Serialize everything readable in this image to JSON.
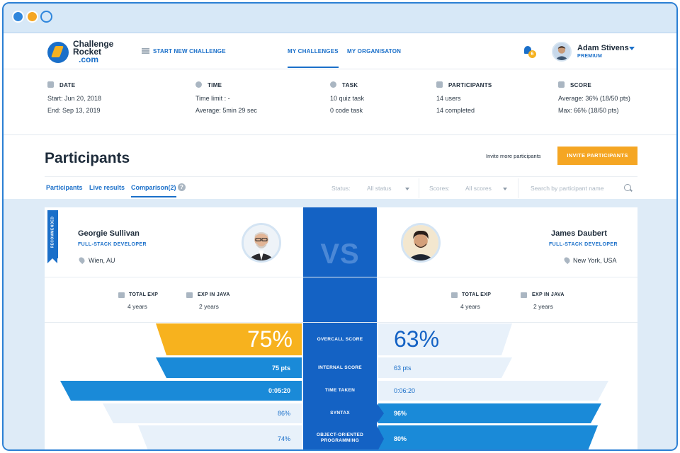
{
  "app": {
    "logo": {
      "line1": "Challenge",
      "line2": "Rocket",
      "line3": ".com"
    },
    "nav": {
      "new_challenge": "START NEW CHALLENGE",
      "my_challenges": "MY CHALLENGES",
      "my_organisation": "MY ORGANISATON"
    },
    "notifications": {
      "count": "6"
    },
    "user": {
      "name": "Adam Stivens",
      "plan": "PREMIUM"
    }
  },
  "stats": {
    "date": {
      "label": "DATE",
      "start": "Start: Jun 20, 2018",
      "end": "End: Sep 13, 2019"
    },
    "time": {
      "label": "TIME",
      "limit": "Time limit :  -",
      "average": "Average: 5min 29 sec"
    },
    "task": {
      "label": "TASK",
      "quiz": "10 quiz task",
      "code": "0 code task"
    },
    "participants": {
      "label": "PARTICIPANTS",
      "users": "14 users",
      "completed": "14 completed"
    },
    "score": {
      "label": "SCORE",
      "average": "Average: 36% (18/50 pts)",
      "max": "Max:  66% (18/50 pts)"
    }
  },
  "participants": {
    "title": "Participants",
    "invite_link": "Invite more participants",
    "invite_button": "INVITE PARTICIPANTS",
    "tabs": [
      "Participants",
      "Live results",
      "Comparison(2)"
    ],
    "help": "?",
    "filters": {
      "status_label": "Status:",
      "status_value": "All status",
      "scores_label": "Scores:",
      "scores_value": "All scores",
      "search_placeholder": "Search by participant  name"
    }
  },
  "comparison": {
    "vs": "VS",
    "recommended": "RECOMMENDED",
    "left": {
      "name": "Georgie Sullivan",
      "role": "FULL-STACK DEVELOPER",
      "location": "Wien, AU",
      "total_exp_label": "TOTAL EXP",
      "total_exp": "4 years",
      "java_exp_label": "EXP IN JAVA",
      "java_exp": "2 years"
    },
    "right": {
      "name": "James Daubert",
      "role": "FULL-STACK DEVELOPER",
      "location": "New York, USA",
      "total_exp_label": "TOTAL EXP",
      "total_exp": "4 years",
      "java_exp_label": "EXP IN JAVA",
      "java_exp": "2 years"
    },
    "rows": [
      {
        "label": "OVERCALL SCORE",
        "left": "75%",
        "right": "63%"
      },
      {
        "label": "INTERNAL SCORE",
        "left": "75 pts",
        "right": "63 pts"
      },
      {
        "label": "TIME TAKEN",
        "left": "0:05:20",
        "right": "0:06:20"
      },
      {
        "label": "SYNTAX",
        "left": "86%",
        "right": "96%"
      },
      {
        "label": "OBJECT-ORIENTED PROGRAMMING",
        "left": "74%",
        "right": "80%"
      }
    ],
    "colors": {
      "highlight": "#f7b21e",
      "strong": "#1a8ad8",
      "deep": "#1462c4",
      "pale": "#e8f1fa"
    }
  }
}
